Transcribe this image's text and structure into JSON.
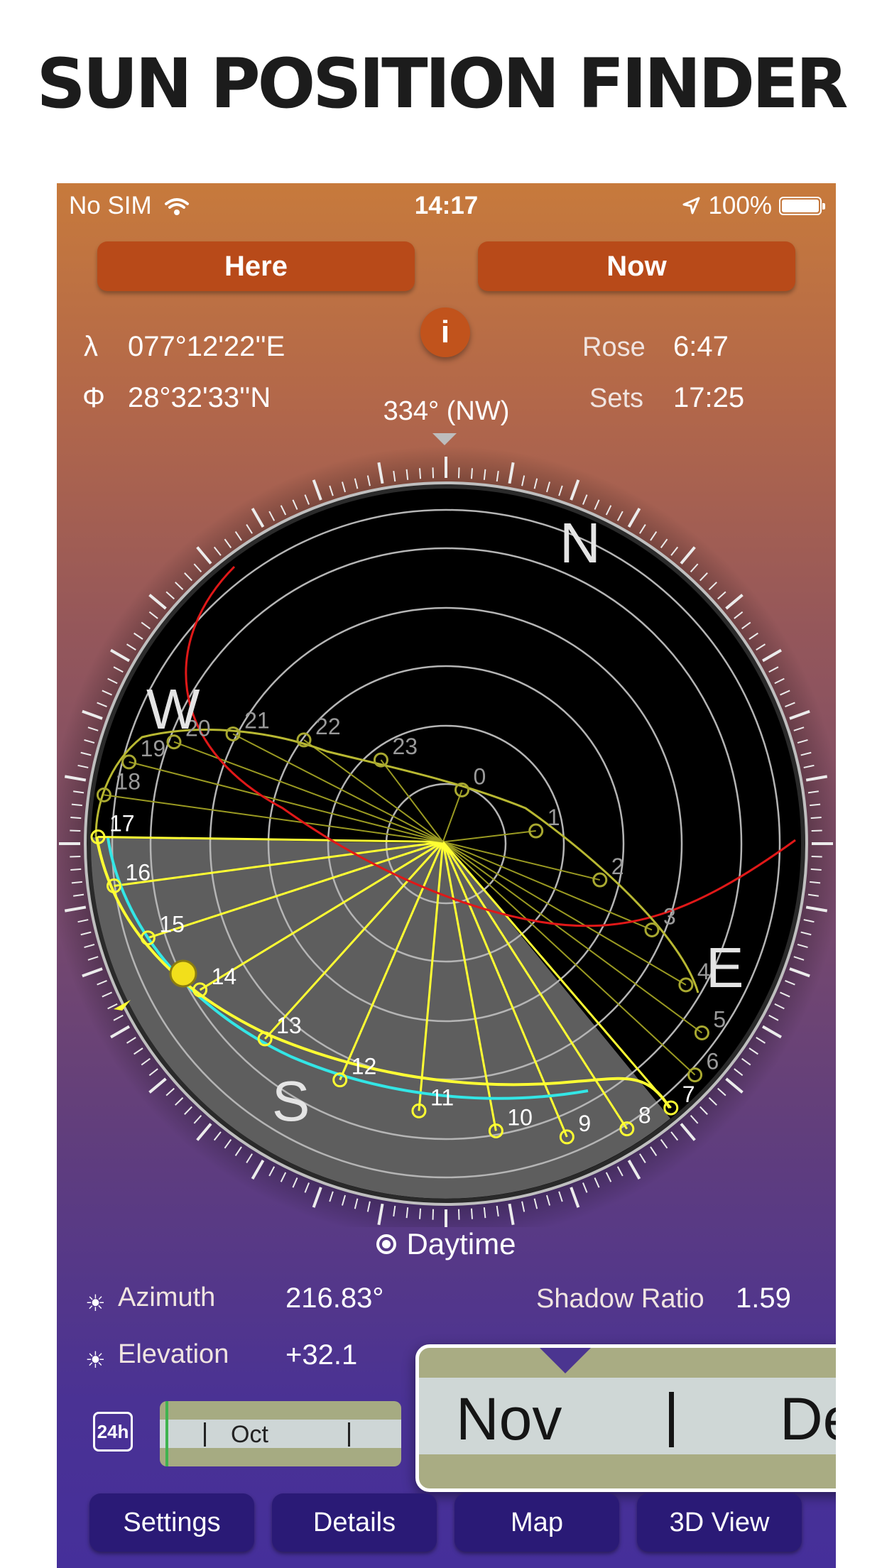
{
  "headline": "SUN POSITION FINDER",
  "status_bar": {
    "carrier": "No SIM",
    "time": "14:17",
    "battery": "100%"
  },
  "buttons": {
    "here": "Here",
    "now": "Now",
    "info": "i"
  },
  "location": {
    "lambda_symbol": "λ",
    "longitude": "077°12'22''E",
    "phi_symbol": "Φ",
    "latitude": "28°32'33''N"
  },
  "sun_times": {
    "rose_label": "Rose",
    "rose_time": "6:47",
    "sets_label": "Sets",
    "sets_time": "17:25"
  },
  "heading": "334° (NW)",
  "compass": {
    "north": "N",
    "east": "E",
    "south": "S",
    "west": "W"
  },
  "hour_labels": [
    "0",
    "1",
    "2",
    "3",
    "4",
    "5",
    "6",
    "7",
    "8",
    "9",
    "10",
    "11",
    "12",
    "13",
    "14",
    "15",
    "16",
    "17",
    "18",
    "19",
    "20",
    "21",
    "22",
    "23"
  ],
  "mode": "Daytime",
  "readouts": {
    "azimuth_label": "Azimuth",
    "azimuth_value": "216.83°",
    "elevation_label": "Elevation",
    "elevation_value": "+32.1",
    "shadow_label": "Shadow Ratio",
    "shadow_value": "1.59"
  },
  "timeline": {
    "toggle": "24h",
    "month_visible": "Oct",
    "zoom_months": [
      "Nov",
      "Dec"
    ]
  },
  "tabs": [
    "Settings",
    "Details",
    "Map",
    "3D View"
  ],
  "colors": {
    "button": "#b84a19",
    "tab": "#2a1a76",
    "sun_path": "#ffff33",
    "horizon": "#ff2222",
    "cyan_path": "#33e6e6",
    "cursor": "#2f8ff0"
  },
  "icons": [
    "wifi-icon",
    "location-arrow-icon",
    "battery-icon",
    "info-icon",
    "sun-icon",
    "radio-selected-icon"
  ]
}
